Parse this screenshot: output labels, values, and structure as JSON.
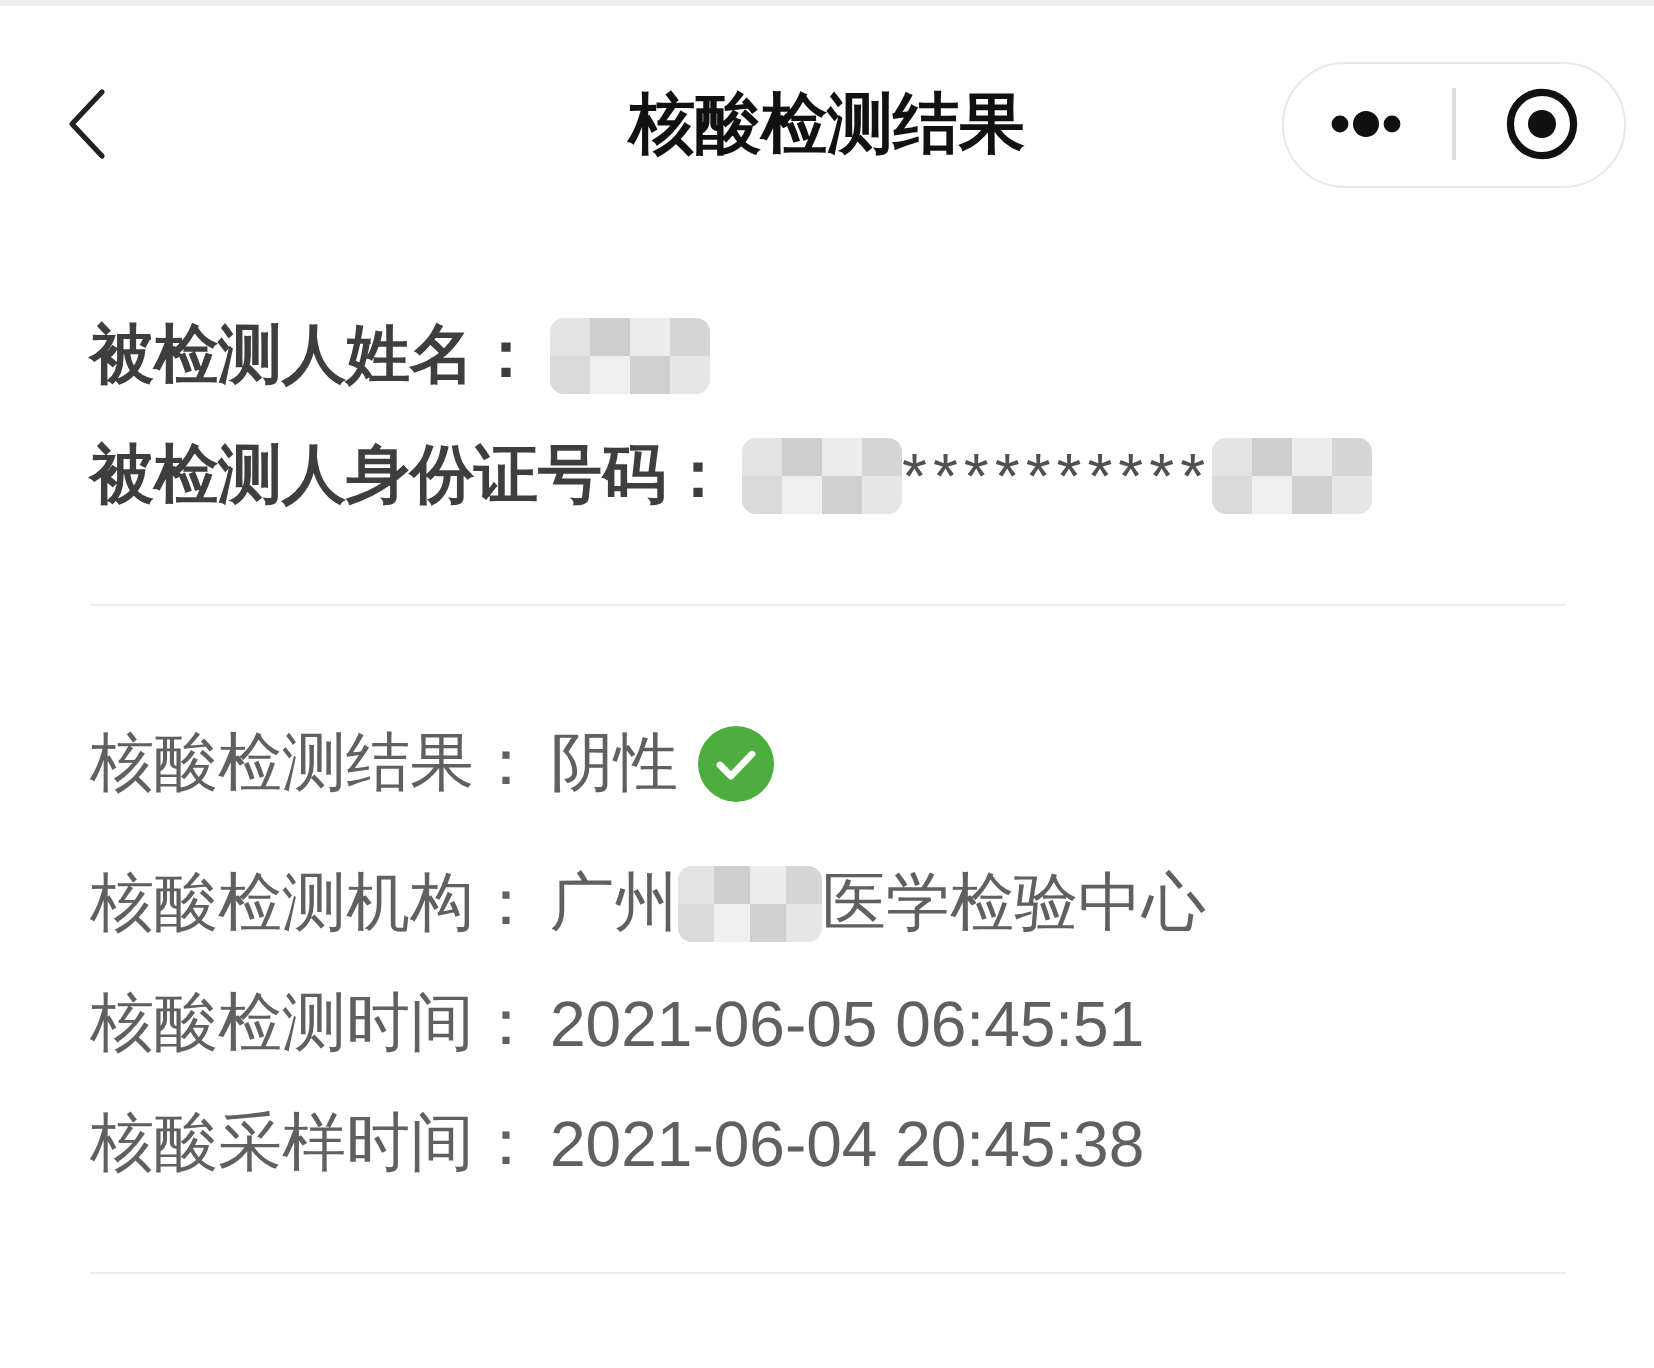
{
  "nav_bar": {
    "title": "核酸检测结果"
  },
  "person": [
    {
      "label": "被检测人姓名：",
      "value": [
        {
          "kind": "redacted"
        }
      ]
    },
    {
      "label": "被检测人身份证号码：",
      "value": [
        {
          "kind": "redacted"
        },
        {
          "kind": "text",
          "text": "**********"
        },
        {
          "kind": "redacted"
        }
      ]
    }
  ],
  "result": [
    {
      "label": "核酸检测结果：",
      "value": [
        {
          "kind": "text",
          "text": "阴性"
        },
        {
          "kind": "check"
        }
      ]
    },
    {
      "label": "核酸检测机构：",
      "value": [
        {
          "kind": "text",
          "text": "广州"
        },
        {
          "kind": "redacted"
        },
        {
          "kind": "text",
          "text": "医学检验中心"
        }
      ]
    },
    {
      "label": "核酸检测时间：",
      "value": [
        {
          "kind": "text",
          "text": "2021-06-05 06:45:51"
        }
      ]
    },
    {
      "label": "核酸采样时间：",
      "value": [
        {
          "kind": "text",
          "text": "2021-06-04 20:45:38"
        }
      ]
    }
  ]
}
